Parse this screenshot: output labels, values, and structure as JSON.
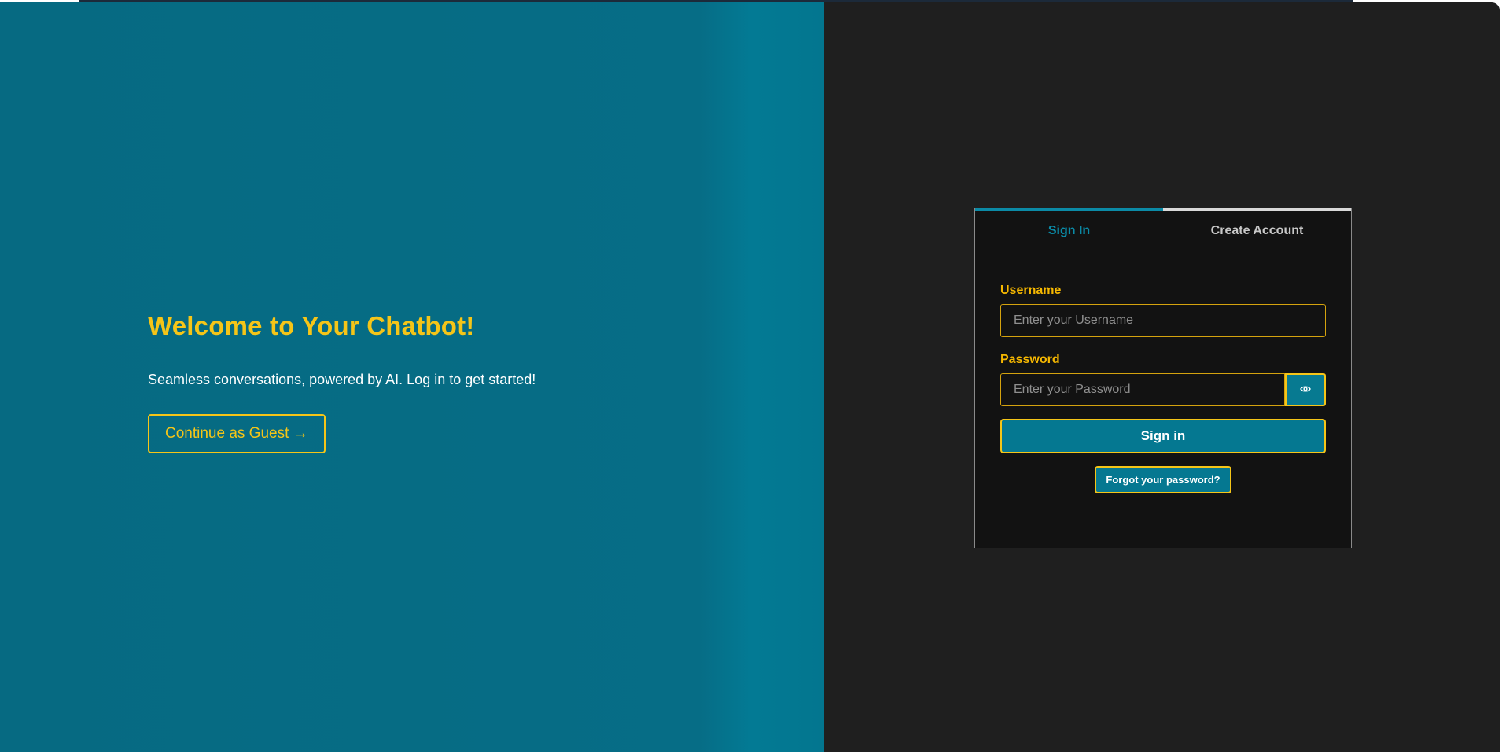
{
  "hero": {
    "title": "Welcome to Your Chatbot!",
    "subtitle": "Seamless conversations, powered by AI. Log in to get started!",
    "guest_button": "Continue as Guest →"
  },
  "auth_card": {
    "tabs": [
      {
        "label": "Sign In",
        "active": true
      },
      {
        "label": "Create Account",
        "active": false
      }
    ],
    "username": {
      "label": "Username",
      "placeholder": "Enter your Username",
      "value": ""
    },
    "password": {
      "label": "Password",
      "placeholder": "Enter your Password",
      "value": "",
      "toggle_icon": "eye-icon"
    },
    "submit_label": "Sign in",
    "forgot_label": "Forgot your password?"
  },
  "colors": {
    "accent_teal": "#057891",
    "accent_yellow": "#f5c518",
    "panel_dark": "#1f1f1f",
    "card_bg": "#121212"
  }
}
